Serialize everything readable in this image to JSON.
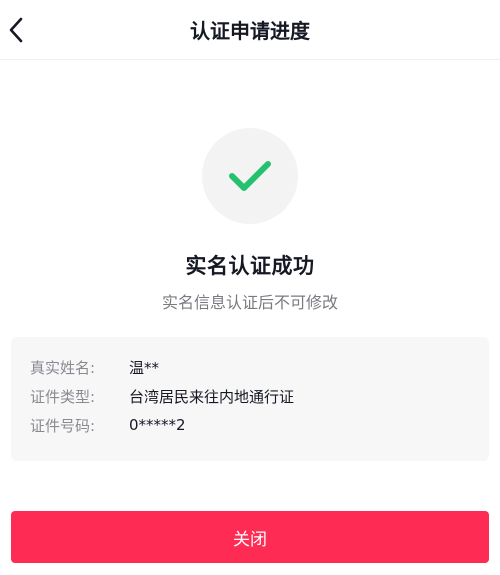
{
  "header": {
    "title": "认证申请进度",
    "back_icon": "chevron-left-icon"
  },
  "status": {
    "icon": "checkmark-icon",
    "icon_color": "#25c16f",
    "title": "实名认证成功",
    "subtitle": "实名信息认证后不可修改"
  },
  "info": {
    "rows": [
      {
        "label": "真实姓名:",
        "value": "温**"
      },
      {
        "label": "证件类型:",
        "value": "台湾居民来往内地通行证"
      },
      {
        "label": "证件号码:",
        "value": "0*****2"
      }
    ]
  },
  "footer": {
    "close_label": "关闭",
    "accent_color": "#fe2c55"
  }
}
